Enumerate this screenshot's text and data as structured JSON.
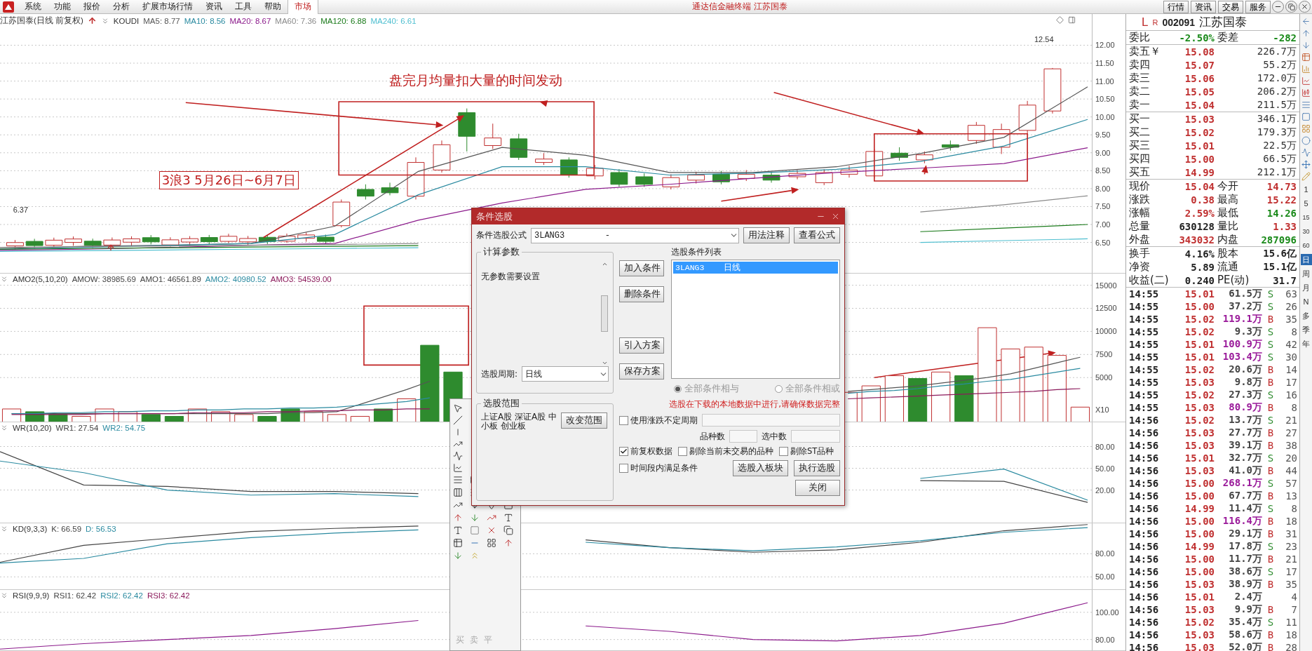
{
  "menu": {
    "items": [
      "系统",
      "功能",
      "报价",
      "分析",
      "扩展市场行情",
      "资讯",
      "工具",
      "帮助"
    ],
    "tab": {
      "label": "市场",
      "selected": true
    },
    "title": "通达信金融终端  江苏国泰",
    "buttons": [
      "行情",
      "资讯",
      "交易",
      "服务"
    ]
  },
  "main_chart": {
    "title": "江苏国泰(日线 前复权)",
    "indicator": "KOUDI",
    "values": [
      {
        "text": "MA5: 8.77",
        "color": "#555555"
      },
      {
        "text": "MA10: 8.56",
        "color": "#2a8aa0"
      },
      {
        "text": "MA20: 8.67",
        "color": "#8b1a8b"
      },
      {
        "text": "MA60: 7.36",
        "color": "#8a8a8a"
      },
      {
        "text": "MA120: 6.88",
        "color": "#1a7a1a"
      },
      {
        "text": "MA240: 6.61",
        "color": "#4fbfd0"
      }
    ],
    "high_label": "12.54",
    "low_label": "6.37",
    "annotations": [
      {
        "kind": "plain",
        "text": "盘完月均量扣大量的时间发动"
      },
      {
        "kind": "boxed",
        "text": "3浪3  5月26日~6月7日"
      }
    ],
    "chart_data": {
      "type": "line",
      "grid": true,
      "ylim": [
        5.65,
        12.87
      ],
      "yticks": [
        {
          "value": 12,
          "label": "12.00"
        },
        {
          "value": 11.5,
          "label": "11.50"
        },
        {
          "value": 11,
          "label": "11.00"
        },
        {
          "value": 10.5,
          "label": "10.50"
        },
        {
          "value": 10,
          "label": "10.00"
        },
        {
          "value": 9.5,
          "label": "9.50"
        },
        {
          "value": 9,
          "label": "9.00"
        },
        {
          "value": 8.5,
          "label": "8.50"
        },
        {
          "value": 8,
          "label": "8.00"
        },
        {
          "value": 7.5,
          "label": "7.50"
        },
        {
          "value": 7,
          "label": "7.00"
        },
        {
          "value": 6.5,
          "label": "6.50"
        }
      ],
      "series": [
        {
          "color": "#555555",
          "values": [
            6.33,
            6.39,
            6.42,
            6.47,
            6.95,
            8.48,
            9.15,
            8.93,
            8.45,
            8.45,
            8.61,
            8.98,
            9.43,
            10.84
          ]
        },
        {
          "color": "#2a8aa0",
          "values": [
            6.31,
            6.36,
            6.42,
            6.47,
            6.72,
            7.83,
            8.61,
            8.61,
            8.38,
            8.43,
            8.54,
            8.76,
            9.19,
            9.93
          ]
        },
        {
          "color": "#8b1a8b",
          "values": [
            6.28,
            6.31,
            6.36,
            6.42,
            6.47,
            7.12,
            7.6,
            7.98,
            8.12,
            8.29,
            8.45,
            8.57,
            8.7,
            9.14
          ]
        },
        {
          "color": "#8a8a8a",
          "values": [
            6.36,
            6.38,
            6.4,
            6.42,
            6.44,
            6.47,
            null,
            null,
            null,
            null,
            null,
            7.35,
            7.55,
            7.8
          ]
        },
        {
          "color": "#1a7a1a",
          "values": [
            6.31,
            6.33,
            6.35,
            6.37,
            6.39,
            6.41,
            null,
            null,
            null,
            null,
            null,
            6.8,
            6.9,
            7.0
          ]
        },
        {
          "color": "#4fbfd0",
          "values": [
            6.25,
            6.27,
            6.29,
            6.31,
            6.33,
            6.35,
            null,
            null,
            null,
            null,
            null,
            6.5,
            6.55,
            6.6
          ]
        }
      ]
    }
  },
  "panels": [
    {
      "kind": "volume",
      "title": "AMO2(5,10,20)",
      "values": [
        {
          "text": "AMOW: 38985.69",
          "color": "#444444"
        },
        {
          "text": "AMO1: 46561.89",
          "color": "#444444"
        },
        {
          "text": "AMO2: 40980.52",
          "color": "#2a8aa0"
        },
        {
          "text": "AMO3: 54539.00",
          "color": "#8b1a5b"
        }
      ],
      "scale_label": "X10",
      "chart_data": {
        "type": "bar",
        "stacked": true,
        "grid": true,
        "ylim": [
          230,
          16260
        ],
        "yticks": [
          {
            "value": 15000,
            "label": "15000"
          },
          {
            "value": 12500,
            "label": "12500"
          },
          {
            "value": 10000,
            "label": "10000"
          },
          {
            "value": 7500,
            "label": "7500"
          },
          {
            "value": 5000,
            "label": "5000"
          }
        ],
        "series": [
          {
            "color": "#c03030",
            "values": [
              1600,
              null,
              null,
              800,
              1600,
              1300,
              null,
              null,
              1600,
              1300,
              1000,
              null,
              null,
              1300,
              1000,
              800,
              null,
              2700,
              null,
              null,
              null,
              null,
              null,
              null,
              null,
              null,
              null,
              null,
              null,
              null,
              null,
              null,
              null,
              null,
              null,
              null,
              3400,
              4100,
              5200,
              null,
              5600,
              null,
              10400,
              8100,
              8300,
              7400,
              1800
            ]
          },
          {
            "color": "#2e8b2e",
            "values": [
              null,
              1300,
              1000,
              null,
              null,
              null,
              1000,
              800,
              null,
              null,
              null,
              800,
              1600,
              null,
              null,
              null,
              1600,
              null,
              8500,
              5600,
              null,
              null,
              null,
              null,
              null,
              null,
              null,
              null,
              null,
              null,
              null,
              null,
              null,
              null,
              null,
              null,
              null,
              null,
              null,
              4900,
              null,
              5200,
              null,
              null,
              null,
              null,
              null
            ]
          },
          {
            "type": "line",
            "color": "#555555",
            "values": [
              1100,
              1100,
              1100,
              1100,
              1100,
              1100,
              1100,
              1100,
              1100,
              1100,
              1100,
              1100,
              1200,
              1200,
              1300,
              2100,
              2900,
              3700,
              4600,
              null,
              null,
              null,
              null,
              null,
              null,
              null,
              null,
              null,
              null,
              null,
              null,
              null,
              null,
              null,
              null,
              null,
              3500,
              3700,
              3900,
              4100,
              4400,
              4700,
              5000,
              5400,
              6000,
              6600,
              7200
            ]
          },
          {
            "type": "line",
            "color": "#2a8aa0",
            "values": [
              1100,
              1100,
              1200,
              1200,
              1300,
              1300,
              1400,
              1400,
              1500,
              1500,
              1600,
              1600,
              1700,
              1700,
              1800,
              2000,
              2200,
              2400,
              2800,
              null,
              null,
              null,
              null,
              null,
              null,
              null,
              null,
              null,
              null,
              null,
              null,
              null,
              null,
              null,
              null,
              null,
              3300,
              3500,
              3600,
              3800,
              4100,
              4300,
              4600,
              4800,
              5200,
              5600,
              6000
            ]
          },
          {
            "type": "line",
            "color": "#8b1a5b",
            "values": [
              1000,
              1000,
              1000,
              1000,
              1100,
              1100,
              1100,
              1100,
              1200,
              1200,
              1200,
              1300,
              1300,
              1400,
              1400,
              1500,
              1500,
              1600,
              1600,
              null,
              null,
              null,
              null,
              null,
              null,
              null,
              null,
              null,
              null,
              null,
              null,
              null,
              null,
              null,
              null,
              null,
              2700,
              2800,
              2900,
              3000,
              3100,
              3200,
              3300,
              3400,
              3500,
              3700,
              3800
            ]
          }
        ]
      }
    },
    {
      "kind": "wr",
      "title": "WR(10,20)",
      "values": [
        {
          "text": "WR1: 27.54",
          "color": "#444444"
        },
        {
          "text": "WR2: 54.75",
          "color": "#2a8aa0"
        }
      ],
      "chart_data": {
        "type": "line",
        "grid": true,
        "ylim": [
          -25,
          113.5
        ],
        "yticks": [
          {
            "value": 80,
            "label": "80.00"
          },
          {
            "value": 50,
            "label": "50.00"
          },
          {
            "value": 20,
            "label": "20.00"
          }
        ],
        "series": [
          {
            "color": "#444444",
            "values": [
              73,
              27,
              25,
              18,
              18,
              15,
              null,
              null,
              null,
              null,
              null,
              33,
              32,
              3
            ]
          },
          {
            "color": "#2a8aa0",
            "values": [
              60,
              44,
              20,
              13,
              15,
              11,
              null,
              null,
              null,
              null,
              null,
              36,
              49,
              6
            ]
          }
        ]
      }
    },
    {
      "kind": "kd",
      "title": "KD(9,3,3)",
      "values": [
        {
          "text": "K: 66.59",
          "color": "#444444"
        },
        {
          "text": "D: 56.53",
          "color": "#2a8aa0"
        }
      ],
      "chart_data": {
        "type": "line",
        "grid": true,
        "ylim": [
          33.9,
          119.6
        ],
        "yticks": [
          {
            "value": 80,
            "label": "80.00"
          },
          {
            "value": 50,
            "label": "50.00"
          }
        ],
        "series": [
          {
            "color": "#444444",
            "values": [
              69,
              91,
              100,
              109,
              113,
              116,
              null,
              98,
              88,
              82,
              85,
              95,
              110,
              118
            ]
          },
          {
            "color": "#2a8aa0",
            "values": [
              68,
              74,
              93,
              101,
              107,
              111,
              null,
              95,
              88,
              84,
              89,
              97,
              108,
              114
            ]
          }
        ]
      }
    },
    {
      "kind": "rsi",
      "title": "RSI(9,9,9)",
      "values": [
        {
          "text": "RSI1: 62.42",
          "color": "#444444"
        },
        {
          "text": "RSI2: 62.42",
          "color": "#2a8aa0"
        },
        {
          "text": "RSI3: 62.42",
          "color": "#8b1a5b"
        }
      ],
      "chart_data": {
        "type": "line",
        "grid": true,
        "ylim": [
          72.1,
          116.4
        ],
        "yticks": [
          {
            "value": 100,
            "label": "100.00"
          },
          {
            "value": 80,
            "label": "80.00"
          }
        ],
        "series": [
          {
            "color": "#8b1a8b",
            "values": [
              73,
              77,
              80,
              83,
              88,
              94,
              null,
              90,
              86,
              80,
              79,
              83,
              92,
              107
            ]
          }
        ]
      }
    }
  ],
  "quote": {
    "flag": "L",
    "mark": "R",
    "code": "002091",
    "name": "江苏国泰",
    "ratio": [
      {
        "label": "委比",
        "value": "-2.50%",
        "color": "#1a8a1a"
      },
      {
        "label": "委差",
        "value": "-282",
        "color": "#1a8a1a"
      }
    ],
    "sells": [
      {
        "label": "卖五￥",
        "price": "15.08",
        "volume": "226.7万"
      },
      {
        "label": "卖四",
        "price": "15.07",
        "volume": "55.2万"
      },
      {
        "label": "卖三",
        "price": "15.06",
        "volume": "172.0万"
      },
      {
        "label": "卖二",
        "price": "15.05",
        "volume": "206.2万"
      },
      {
        "label": "卖一",
        "price": "15.04",
        "volume": "211.5万"
      }
    ],
    "buys": [
      {
        "label": "买一",
        "price": "15.03",
        "volume": "346.1万"
      },
      {
        "label": "买二",
        "price": "15.02",
        "volume": "179.3万"
      },
      {
        "label": "买三",
        "price": "15.01",
        "volume": "22.5万"
      },
      {
        "label": "买四",
        "price": "15.00",
        "volume": "66.5万"
      },
      {
        "label": "买五",
        "price": "14.99",
        "volume": "212.1万"
      }
    ],
    "stats": [
      {
        "cells": [
          {
            "label": "现价",
            "value": "15.04",
            "color": "#c03030"
          },
          {
            "label": "今开",
            "value": "14.73",
            "color": "#c03030"
          }
        ]
      },
      {
        "cells": [
          {
            "label": "涨跌",
            "value": "0.38",
            "color": "#c03030"
          },
          {
            "label": "最高",
            "value": "15.22",
            "color": "#c03030"
          }
        ]
      },
      {
        "cells": [
          {
            "label": "涨幅",
            "value": "2.59%",
            "color": "#c03030"
          },
          {
            "label": "最低",
            "value": "14.26",
            "color": "#1a8a1a"
          }
        ]
      },
      {
        "cells": [
          {
            "label": "总量",
            "value": "630128",
            "color": "#222222"
          },
          {
            "label": "量比",
            "value": "1.33",
            "color": "#c03030"
          }
        ]
      },
      {
        "cells": [
          {
            "label": "外盘",
            "value": "343032",
            "color": "#c03030"
          },
          {
            "label": "内盘",
            "value": "287096",
            "color": "#1a8a1a"
          }
        ]
      }
    ],
    "info": [
      {
        "cells": [
          {
            "label": "换手",
            "value": "4.16%"
          },
          {
            "label": "股本",
            "value": "15.6亿"
          }
        ]
      },
      {
        "cells": [
          {
            "label": "净资",
            "value": "5.89"
          },
          {
            "label": "流通",
            "value": "15.1亿"
          }
        ]
      },
      {
        "cells": [
          {
            "label": "收益(二)",
            "value": "0.240"
          },
          {
            "label": "PE(动)",
            "value": "31.7"
          }
        ]
      }
    ]
  },
  "ticks": [
    {
      "time": "14:55",
      "price": "15.01",
      "volume": "61.5万",
      "big": false,
      "kind": "sell",
      "side": "S",
      "count": "63"
    },
    {
      "time": "14:55",
      "price": "15.00",
      "volume": "37.2万",
      "big": false,
      "kind": "sell",
      "side": "S",
      "count": "26"
    },
    {
      "time": "14:55",
      "price": "15.02",
      "volume": "119.1万",
      "big": true,
      "kind": "buy",
      "side": "B",
      "count": "35"
    },
    {
      "time": "14:55",
      "price": "15.02",
      "volume": "9.3万",
      "big": false,
      "kind": "sell",
      "side": "S",
      "count": "8"
    },
    {
      "time": "14:55",
      "price": "15.01",
      "volume": "100.9万",
      "big": true,
      "kind": "sell",
      "side": "S",
      "count": "42"
    },
    {
      "time": "14:55",
      "price": "15.01",
      "volume": "103.4万",
      "big": true,
      "kind": "sell",
      "side": "S",
      "count": "30"
    },
    {
      "time": "14:55",
      "price": "15.02",
      "volume": "20.6万",
      "big": false,
      "kind": "buy",
      "side": "B",
      "count": "14"
    },
    {
      "time": "14:55",
      "price": "15.03",
      "volume": "9.8万",
      "big": false,
      "kind": "buy",
      "side": "B",
      "count": "17"
    },
    {
      "time": "14:55",
      "price": "15.02",
      "volume": "27.3万",
      "big": false,
      "kind": "sell",
      "side": "S",
      "count": "16"
    },
    {
      "time": "14:55",
      "price": "15.03",
      "volume": "80.9万",
      "big": true,
      "kind": "buy",
      "side": "B",
      "count": "8"
    },
    {
      "time": "14:56",
      "price": "15.02",
      "volume": "13.7万",
      "big": false,
      "kind": "sell",
      "side": "S",
      "count": "21"
    },
    {
      "time": "14:56",
      "price": "15.03",
      "volume": "27.7万",
      "big": false,
      "kind": "buy",
      "side": "B",
      "count": "27"
    },
    {
      "time": "14:56",
      "price": "15.03",
      "volume": "39.1万",
      "big": false,
      "kind": "buy",
      "side": "B",
      "count": "38"
    },
    {
      "time": "14:56",
      "price": "15.01",
      "volume": "32.7万",
      "big": false,
      "kind": "sell",
      "side": "S",
      "count": "20"
    },
    {
      "time": "14:56",
      "price": "15.03",
      "volume": "41.0万",
      "big": false,
      "kind": "buy",
      "side": "B",
      "count": "44"
    },
    {
      "time": "14:56",
      "price": "15.00",
      "volume": "268.1万",
      "big": true,
      "kind": "sell",
      "side": "S",
      "count": "57"
    },
    {
      "time": "14:56",
      "price": "15.00",
      "volume": "67.7万",
      "big": false,
      "kind": "buy",
      "side": "B",
      "count": "13"
    },
    {
      "time": "14:56",
      "price": "14.99",
      "volume": "11.4万",
      "big": false,
      "kind": "sell",
      "side": "S",
      "count": "8"
    },
    {
      "time": "14:56",
      "price": "15.00",
      "volume": "116.4万",
      "big": true,
      "kind": "buy",
      "side": "B",
      "count": "18"
    },
    {
      "time": "14:56",
      "price": "15.00",
      "volume": "29.1万",
      "big": false,
      "kind": "buy",
      "side": "B",
      "count": "31"
    },
    {
      "time": "14:56",
      "price": "14.99",
      "volume": "17.8万",
      "big": false,
      "kind": "sell",
      "side": "S",
      "count": "23"
    },
    {
      "time": "14:56",
      "price": "15.00",
      "volume": "11.7万",
      "big": false,
      "kind": "buy",
      "side": "B",
      "count": "21"
    },
    {
      "time": "14:56",
      "price": "15.00",
      "volume": "38.6万",
      "big": false,
      "kind": "sell",
      "side": "S",
      "count": "17"
    },
    {
      "time": "14:56",
      "price": "15.03",
      "volume": "38.9万",
      "big": false,
      "kind": "buy",
      "side": "B",
      "count": "35"
    },
    {
      "time": "14:56",
      "price": "15.01",
      "volume": "2.4万",
      "big": false,
      "kind": "none",
      "count": "4"
    },
    {
      "time": "14:56",
      "price": "15.03",
      "volume": "9.9万",
      "big": false,
      "kind": "buy",
      "side": "B",
      "count": "7"
    },
    {
      "time": "14:56",
      "price": "15.02",
      "volume": "35.4万",
      "big": false,
      "kind": "sell",
      "side": "S",
      "count": "11"
    },
    {
      "time": "14:56",
      "price": "15.03",
      "volume": "58.6万",
      "big": false,
      "kind": "buy",
      "side": "B",
      "count": "18"
    },
    {
      "time": "14:56",
      "price": "15.03",
      "volume": "52.0万",
      "big": false,
      "kind": "buy",
      "side": "B",
      "count": "28"
    }
  ],
  "period_bar": [
    {
      "label": "1",
      "selected": false
    },
    {
      "label": "5",
      "selected": false
    },
    {
      "label": "15",
      "selected": false
    },
    {
      "label": "30",
      "selected": false
    },
    {
      "label": "60",
      "selected": false
    },
    {
      "label": "日",
      "selected": true
    },
    {
      "label": "周",
      "selected": false
    },
    {
      "label": "月",
      "selected": false
    },
    {
      "label": "N",
      "selected": false
    },
    {
      "label": "多",
      "selected": false
    },
    {
      "label": "季",
      "selected": false
    },
    {
      "label": "年",
      "selected": false
    }
  ],
  "dialog": {
    "title": "条件选股",
    "formula_label": "条件选股公式",
    "formula_value": "3LANG3        -",
    "top_buttons": [
      "用法注释",
      "查看公式"
    ],
    "params_title": "计算参数",
    "params_text": "无参数需要设置",
    "period_label": "选股周期:",
    "period_value": "日线",
    "scope_title": "选股范围",
    "scope_text": "上证A股 深证A股 中小板 创业板",
    "scope_button": "改变范围",
    "side_buttons": [
      "加入条件",
      "删除条件",
      "引入方案",
      "保存方案"
    ],
    "list_label": "选股条件列表",
    "list_items": [
      {
        "text": "3LANG3    日线",
        "selected": true
      }
    ],
    "radios": [
      {
        "label": "全部条件相与",
        "selected": true,
        "disabled": true
      },
      {
        "label": "全部条件相或",
        "selected": false,
        "disabled": true
      }
    ],
    "warning": "选股在下载的本地数据中进行,请确保数据完整",
    "cycle_check": {
      "label": "使用涨跌不定周期",
      "checked": false
    },
    "count_labels": [
      "品种数",
      "选中数"
    ],
    "checks": [
      {
        "label": "前复权数据",
        "checked": true
      },
      {
        "label": "剔除当前未交易的品种",
        "checked": false
      },
      {
        "label": "剔除ST品种",
        "checked": false
      }
    ],
    "range_check": {
      "label": "时间段内满足条件",
      "checked": false
    },
    "bottom_buttons": [
      "选股入板块",
      "执行选股"
    ],
    "close_button": "关闭"
  },
  "toolbar": {
    "labels": [
      "买",
      "卖",
      "平"
    ],
    "disabled": true
  }
}
